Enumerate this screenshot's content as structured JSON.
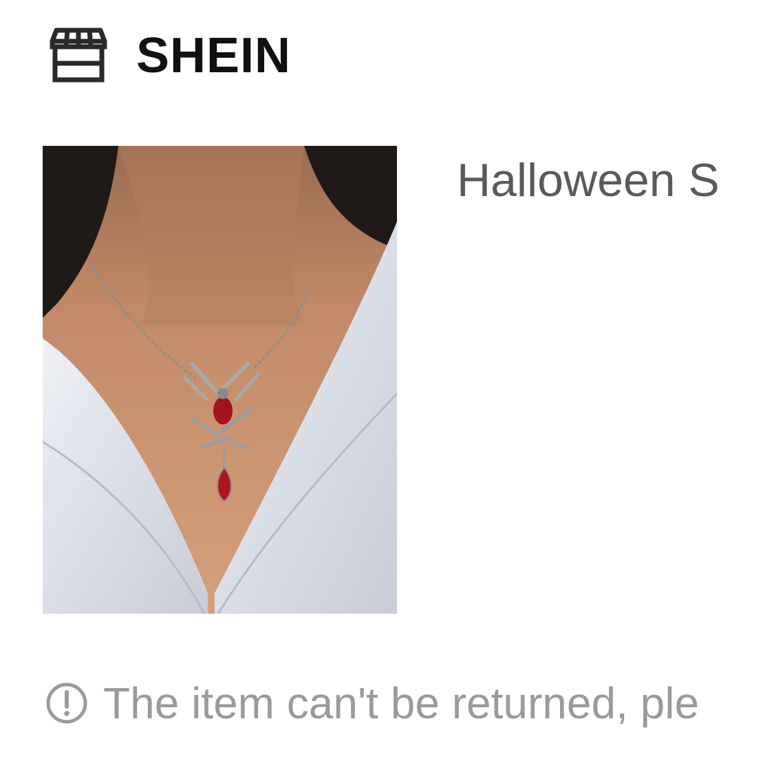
{
  "store": {
    "icon": "storefront-icon",
    "name": "SHEIN"
  },
  "product": {
    "image": "product-photo-necklace",
    "title": "Halloween S"
  },
  "notice": {
    "icon": "exclamation-circle-icon",
    "text": "The item can't be returned, ple"
  },
  "colors": {
    "store_text": "#111111",
    "title_text": "#5a5a5a",
    "notice_text": "#9a9a9a"
  }
}
